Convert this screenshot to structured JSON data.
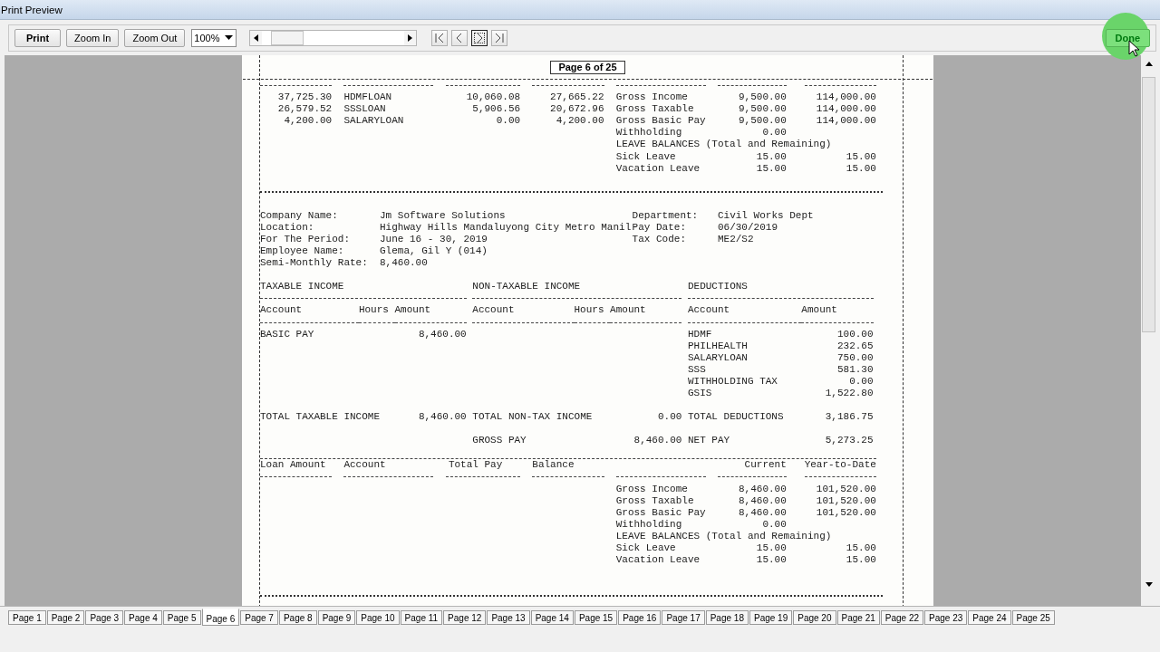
{
  "window": {
    "title": "Print Preview"
  },
  "toolbar": {
    "print": "Print",
    "zoom_in": "Zoom In",
    "zoom_out": "Zoom Out",
    "zoom": "100%",
    "nav": [
      {
        "kind": "first",
        "focused": false
      },
      {
        "kind": "prev",
        "focused": false
      },
      {
        "kind": "next",
        "focused": true
      },
      {
        "kind": "last",
        "focused": false
      }
    ],
    "done": "Done"
  },
  "page_label": "Page 6 of 25",
  "report": [
    {
      "kind": "loans",
      "rows": [
        {
          "loan_amount": "37,725.30",
          "account": "HDMFLOAN",
          "total_pay": "10,060.08",
          "balance": "27,665.22",
          "label": "Gross Income",
          "current": "9,500.00",
          "ytd": "114,000.00"
        },
        {
          "loan_amount": "26,579.52",
          "account": "SSSLOAN",
          "total_pay": "5,906.56",
          "balance": "20,672.96",
          "label": "Gross Taxable",
          "current": "9,500.00",
          "ytd": "114,000.00"
        },
        {
          "loan_amount": "4,200.00",
          "account": "SALARYLOAN",
          "total_pay": "0.00",
          "balance": "4,200.00",
          "label": "Gross Basic Pay",
          "current": "9,500.00",
          "ytd": "114,000.00"
        },
        {
          "label": "Withholding",
          "current": "0.00"
        },
        {
          "label": "LEAVE BALANCES (Total and Remaining)"
        },
        {
          "label": "Sick Leave",
          "current": "15.00",
          "ytd": "15.00"
        },
        {
          "label": "Vacation Leave",
          "current": "15.00",
          "ytd": "15.00"
        }
      ]
    },
    {
      "kind": "separator"
    },
    {
      "kind": "employee",
      "left": [
        {
          "label": "Company Name:",
          "value": "Jm Software Solutions"
        },
        {
          "label": "Location:",
          "value": "Highway Hills Mandaluyong City Metro Manil"
        },
        {
          "label": "For The Period:",
          "value": "June 16 - 30, 2019"
        },
        {
          "label": "Employee Name:",
          "value": "Glema, Gil Y (014)"
        },
        {
          "label": "Semi-Monthly Rate:",
          "value": "8,460.00"
        }
      ],
      "right": [
        {
          "label": "Department:",
          "value": "Civil Works Dept"
        },
        {
          "label": "Pay Date:",
          "value": "06/30/2019"
        },
        {
          "label": "Tax Code:",
          "value": "ME2/S2"
        }
      ]
    },
    {
      "kind": "income",
      "groups": [
        "TAXABLE INCOME",
        "NON-TAXABLE INCOME",
        "DEDUCTIONS"
      ],
      "columns": [
        "Account",
        "Hours",
        "Amount",
        "Account",
        "Hours",
        "Amount",
        "Account",
        "Amount"
      ],
      "rows": [
        {
          "taxable_account": "BASIC PAY",
          "taxable_amount": "8,460.00",
          "deduction_account": "HDMF",
          "deduction_amount": "100.00"
        },
        {
          "deduction_account": "PHILHEALTH",
          "deduction_amount": "232.65"
        },
        {
          "deduction_account": "SALARYLOAN",
          "deduction_amount": "750.00"
        },
        {
          "deduction_account": "SSS",
          "deduction_amount": "581.30"
        },
        {
          "deduction_account": "WITHHOLDING TAX",
          "deduction_amount": "0.00"
        },
        {
          "deduction_account": "GSIS",
          "deduction_amount": "1,522.80"
        }
      ],
      "totals": [
        {
          "taxable_account": "TOTAL TAXABLE INCOME",
          "taxable_amount": "8,460.00",
          "nontax_account": "TOTAL NON-TAX INCOME",
          "nontax_amount": "0.00",
          "deduction_account": "TOTAL DEDUCTIONS",
          "deduction_amount": "3,186.75"
        },
        {
          "nontax_account": "GROSS PAY",
          "nontax_amount": "8,460.00",
          "deduction_account": "NET PAY",
          "deduction_amount": "5,273.25"
        }
      ]
    },
    {
      "kind": "loans",
      "columns": [
        "Loan Amount",
        "Account",
        "Total Pay",
        "Balance",
        "Current",
        "Year-to-Date"
      ],
      "rows": [
        {
          "label": "Gross Income",
          "current": "8,460.00",
          "ytd": "101,520.00"
        },
        {
          "label": "Gross Taxable",
          "current": "8,460.00",
          "ytd": "101,520.00"
        },
        {
          "label": "Gross Basic Pay",
          "current": "8,460.00",
          "ytd": "101,520.00"
        },
        {
          "label": "Withholding",
          "current": "0.00"
        },
        {
          "label": "LEAVE BALANCES (Total and Remaining)"
        },
        {
          "label": "Sick Leave",
          "current": "15.00",
          "ytd": "15.00"
        },
        {
          "label": "Vacation Leave",
          "current": "15.00",
          "ytd": "15.00"
        }
      ]
    },
    {
      "kind": "separator"
    }
  ],
  "tabs": [
    {
      "label": "Page 1",
      "selected": false
    },
    {
      "label": "Page 2",
      "selected": false
    },
    {
      "label": "Page 3",
      "selected": false
    },
    {
      "label": "Page 4",
      "selected": false
    },
    {
      "label": "Page 5",
      "selected": false
    },
    {
      "label": "Page 6",
      "selected": true
    },
    {
      "label": "Page 7",
      "selected": false
    },
    {
      "label": "Page 8",
      "selected": false
    },
    {
      "label": "Page 9",
      "selected": false
    },
    {
      "label": "Page 10",
      "selected": false
    },
    {
      "label": "Page 11",
      "selected": false
    },
    {
      "label": "Page 12",
      "selected": false
    },
    {
      "label": "Page 13",
      "selected": false
    },
    {
      "label": "Page 14",
      "selected": false
    },
    {
      "label": "Page 15",
      "selected": false
    },
    {
      "label": "Page 16",
      "selected": false
    },
    {
      "label": "Page 17",
      "selected": false
    },
    {
      "label": "Page 18",
      "selected": false
    },
    {
      "label": "Page 19",
      "selected": false
    },
    {
      "label": "Page 20",
      "selected": false
    },
    {
      "label": "Page 21",
      "selected": false
    },
    {
      "label": "Page 22",
      "selected": false
    },
    {
      "label": "Page 23",
      "selected": false
    },
    {
      "label": "Page 24",
      "selected": false
    },
    {
      "label": "Page 25",
      "selected": false
    }
  ]
}
